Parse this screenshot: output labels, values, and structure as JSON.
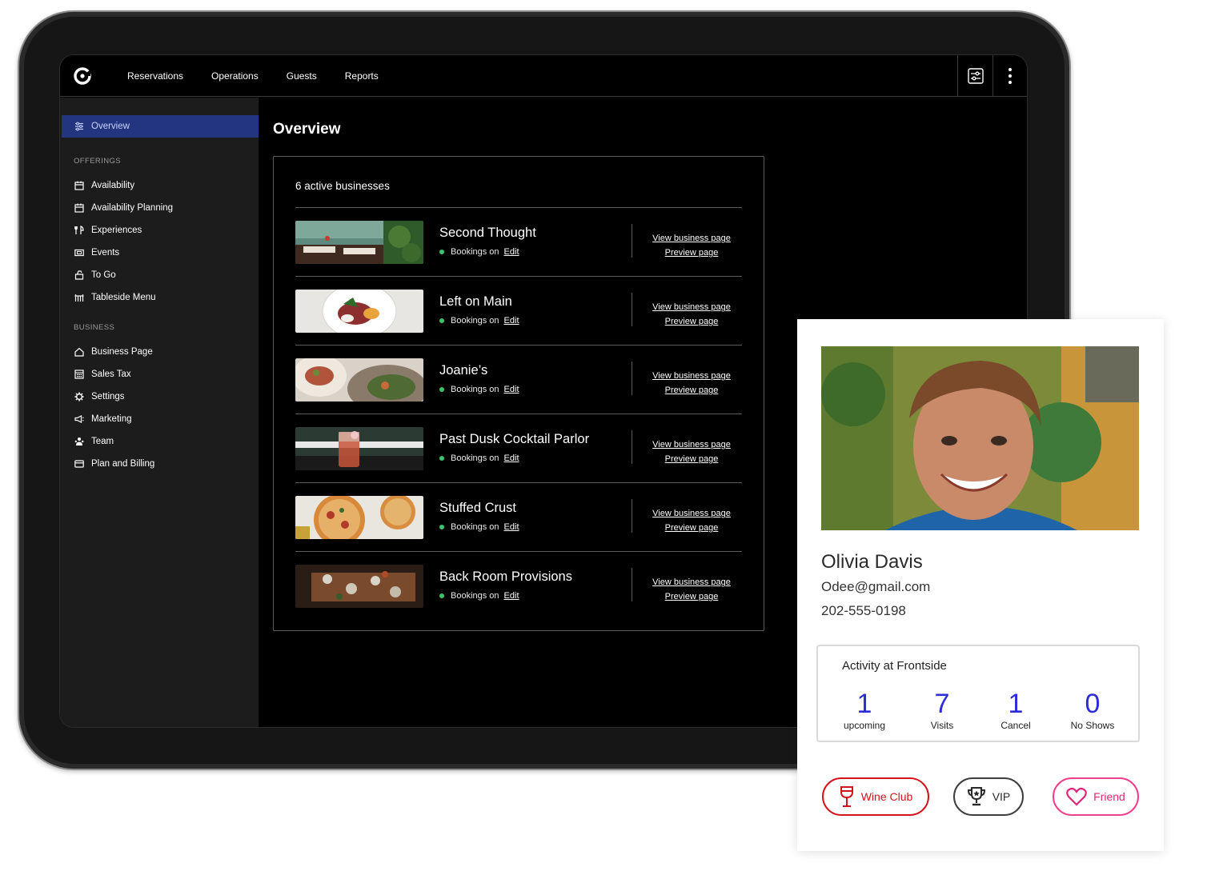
{
  "nav": {
    "items": [
      "Reservations",
      "Operations",
      "Guests",
      "Reports"
    ]
  },
  "sidebar": {
    "overview_label": "Overview",
    "offerings_heading": "OFFERINGS",
    "offerings": [
      {
        "label": "Availability",
        "icon": "calendar-icon"
      },
      {
        "label": "Availability Planning",
        "icon": "calendar-icon"
      },
      {
        "label": "Experiences",
        "icon": "utensils-icon"
      },
      {
        "label": "Events",
        "icon": "ticket-icon"
      },
      {
        "label": "To Go",
        "icon": "takeout-bag-icon"
      },
      {
        "label": "Tableside Menu",
        "icon": "table-icon"
      }
    ],
    "business_heading": "BUSINESS",
    "business": [
      {
        "label": "Business Page",
        "icon": "home-icon"
      },
      {
        "label": "Sales Tax",
        "icon": "calculator-icon"
      },
      {
        "label": "Settings",
        "icon": "gear-icon"
      },
      {
        "label": "Marketing",
        "icon": "megaphone-icon"
      },
      {
        "label": "Team",
        "icon": "team-icon"
      },
      {
        "label": "Plan and Billing",
        "icon": "credit-card-icon"
      }
    ]
  },
  "main": {
    "title": "Overview",
    "count_label": "6 active businesses",
    "status_label": "Bookings on",
    "edit_label": "Edit",
    "view_label": "View business page",
    "preview_label": "Preview page",
    "businesses": [
      {
        "name": "Second Thought"
      },
      {
        "name": "Left on Main"
      },
      {
        "name": "Joanie’s"
      },
      {
        "name": "Past Dusk Cocktail Parlor"
      },
      {
        "name": "Stuffed Crust"
      },
      {
        "name": "Back Room Provisions"
      }
    ]
  },
  "guest": {
    "name": "Olivia Davis",
    "email": "Odee@gmail.com",
    "phone": "202-555-0198",
    "activity_title": "Activity at Frontside",
    "stats": [
      {
        "value": "1",
        "label": "upcoming"
      },
      {
        "value": "7",
        "label": "Visits"
      },
      {
        "value": "1",
        "label": "Cancel"
      },
      {
        "value": "0",
        "label": "No Shows"
      }
    ],
    "tags": {
      "wine": "Wine Club",
      "vip": "VIP",
      "friend": "Friend"
    }
  },
  "colors": {
    "accent": "#2c2dd6",
    "active_nav": "#243580",
    "status_green": "#3cc46a",
    "wine_red": "#d4141c",
    "friend_pink": "#ef3e8c"
  }
}
